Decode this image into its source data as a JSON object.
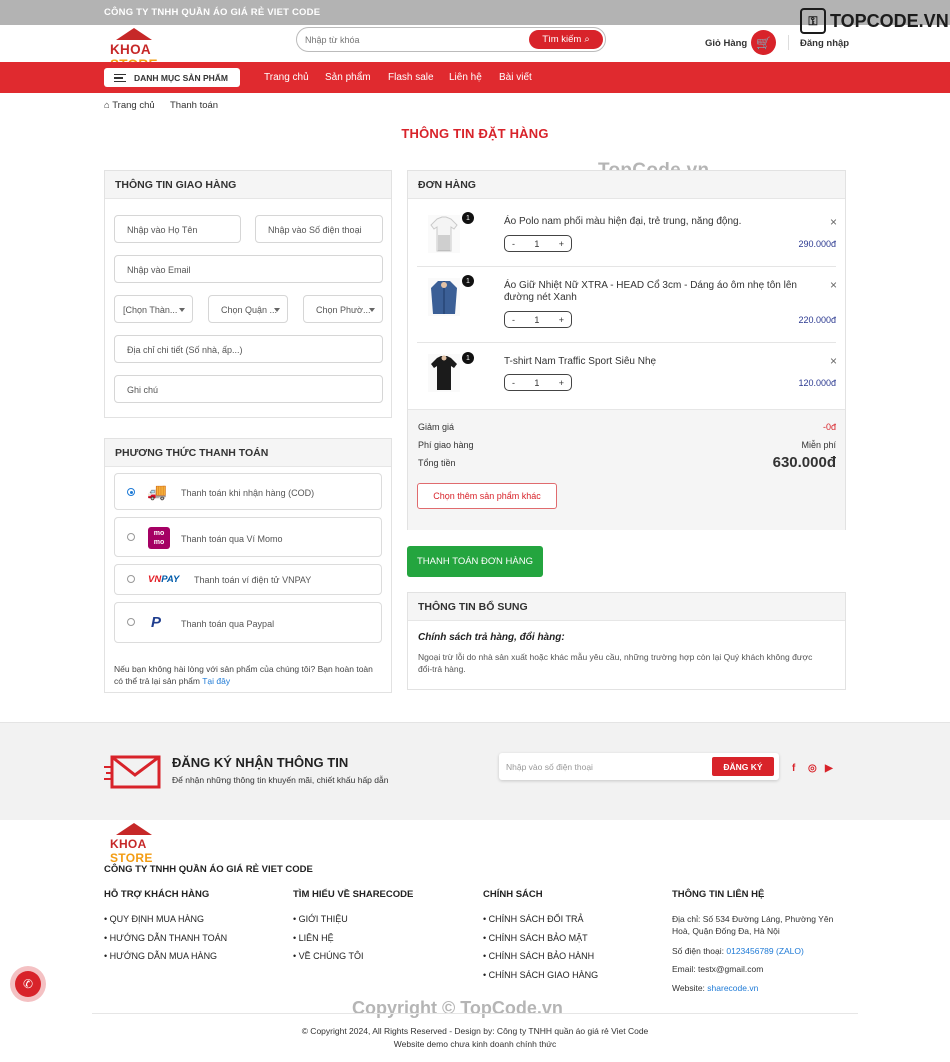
{
  "topbar": {
    "company": "CÔNG TY TNHH QUẦN ÁO GIÁ RẺ VIET CODE",
    "watermark_logo": "TOPCODE.VN"
  },
  "header": {
    "logo_k": "KHOA",
    "logo_s": "STORE",
    "search_placeholder": "Nhập từ khóa",
    "search_button": "Tìm kiếm",
    "cart_label": "Giỏ Hàng",
    "login": "Đăng nhập"
  },
  "nav": {
    "category_button": "DANH MỤC SẢN PHẨM",
    "links": [
      "Trang chủ",
      "Sản phẩm",
      "Flash sale",
      "Liên hệ",
      "Bài viết"
    ]
  },
  "breadcrumb": [
    "Trang chủ",
    "Thanh toán"
  ],
  "page_title": "THÔNG TIN ĐẶT HÀNG",
  "watermark_mid": "TopCode.vn",
  "shipping": {
    "title": "THÔNG TIN GIAO HÀNG",
    "name_placeholder": "Nhập vào Họ Tên",
    "phone_placeholder": "Nhập vào Số điện thoại",
    "email_placeholder": "Nhập vào Email",
    "province": "[Chọn Thàn...",
    "district": "Chọn Quận ...",
    "ward": "Chọn Phườ...",
    "address_placeholder": "Địa chỉ chi tiết (Số nhà, ấp...)",
    "note_placeholder": "Ghi chú"
  },
  "payment": {
    "title": "PHƯƠNG THỨC THANH TOÁN",
    "options": [
      {
        "label": "Thanh toán khi nhận hàng (COD)",
        "selected": true
      },
      {
        "label": "Thanh toán qua Ví Momo",
        "selected": false
      },
      {
        "label": "Thanh toán ví điện tử VNPAY",
        "selected": false
      },
      {
        "label": "Thanh toán qua Paypal",
        "selected": false
      }
    ],
    "momo_logo": "mo mo",
    "vnpay_logo_vn": "VN",
    "vnpay_logo_pay": "PAY",
    "paypal_logo": "P",
    "note": "Nếu bạn không hài lòng với sản phẩm của chúng tôi? Bạn hoàn toàn có thể trả lại sản phẩm",
    "note_link": "Tại đây"
  },
  "order": {
    "title": "ĐƠN HÀNG",
    "items": [
      {
        "name": "Áo Polo nam phối màu hiện đại, trẻ trung, năng động.",
        "qty": "1",
        "badge": "1",
        "price": "290.000đ"
      },
      {
        "name": "Áo Giữ Nhiệt Nữ XTRA - HEAD Cổ 3cm - Dáng áo ôm nhẹ tôn lên đường nét Xanh",
        "qty": "1",
        "badge": "1",
        "price": "220.000đ"
      },
      {
        "name": "T-shirt Nam Traffic Sport Siêu Nhẹ",
        "qty": "1",
        "badge": "1",
        "price": "120.000đ"
      }
    ],
    "discount_label": "Giảm giá",
    "discount_value": "-0đ",
    "shipping_label": "Phí giao hàng",
    "shipping_value": "Miễn phí",
    "total_label": "Tổng tiền",
    "total_value": "630.000đ",
    "more_button": "Chọn thêm sản phẩm khác"
  },
  "checkout_button": "THANH TOÁN ĐƠN HÀNG",
  "extra": {
    "title": "THÔNG TIN BỔ SUNG",
    "policy_title": "Chính sách trả hàng, đổi hàng:",
    "policy_text": "Ngoại trừ lỗi do nhà sản xuất hoặc khác mẫu yêu cầu, những trường hợp còn lại Quý khách không được đổi-trả hàng."
  },
  "newsletter": {
    "title": "ĐĂNG KÝ NHẬN THÔNG TIN",
    "subtitle": "Để nhận những thông tin khuyến mãi, chiết khấu hấp dẫn",
    "placeholder": "Nhập vào số điện thoại",
    "button": "ĐĂNG KÝ"
  },
  "footer": {
    "company": "CÔNG TY TNHH QUẦN ÁO GIÁ RẺ VIET CODE",
    "col1": {
      "title": "HỖ TRỢ KHÁCH HÀNG",
      "items": [
        "• QUY ĐỊNH MUA HÀNG",
        "• HƯỚNG DẪN THANH TOÁN",
        "• HƯỚNG DẪN MUA HÀNG"
      ]
    },
    "col2": {
      "title": "TÌM HIỂU VỀ SHARECODE",
      "items": [
        "• GIỚI THIỆU",
        "• LIÊN HỆ",
        "• VỀ CHÚNG TÔI"
      ]
    },
    "col3": {
      "title": "CHÍNH SÁCH",
      "items": [
        "• CHÍNH SÁCH ĐỔI TRẢ",
        "• CHÍNH SÁCH BẢO MẬT",
        "• CHÍNH SÁCH BẢO HÀNH",
        "• CHÍNH SÁCH GIAO HÀNG"
      ]
    },
    "col4": {
      "title": "THÔNG TIN LIÊN HỆ",
      "address": "Địa chỉ: Số 534 Đường Láng, Phường Yên Hoà, Quận Đống Đa, Hà Nội",
      "phone_label": "Số điện thoại:",
      "phone": "0123456789 (ZALO)",
      "email": "Email: testx@gmail.com",
      "website_label": "Website:",
      "website": "sharecode.vn"
    },
    "copyright_watermark": "Copyright © TopCode.vn",
    "copyright": "© Copyright 2024, All Rights Reserved - Design by: Công ty TNHH quần áo giá rẻ Viet Code",
    "demo_note": "Website demo chưa kinh doanh chính thức"
  },
  "colors": {
    "brand_red": "#d8232a",
    "green": "#24a53f",
    "price_blue": "#2b3990",
    "link_blue": "#1e7ad6"
  }
}
